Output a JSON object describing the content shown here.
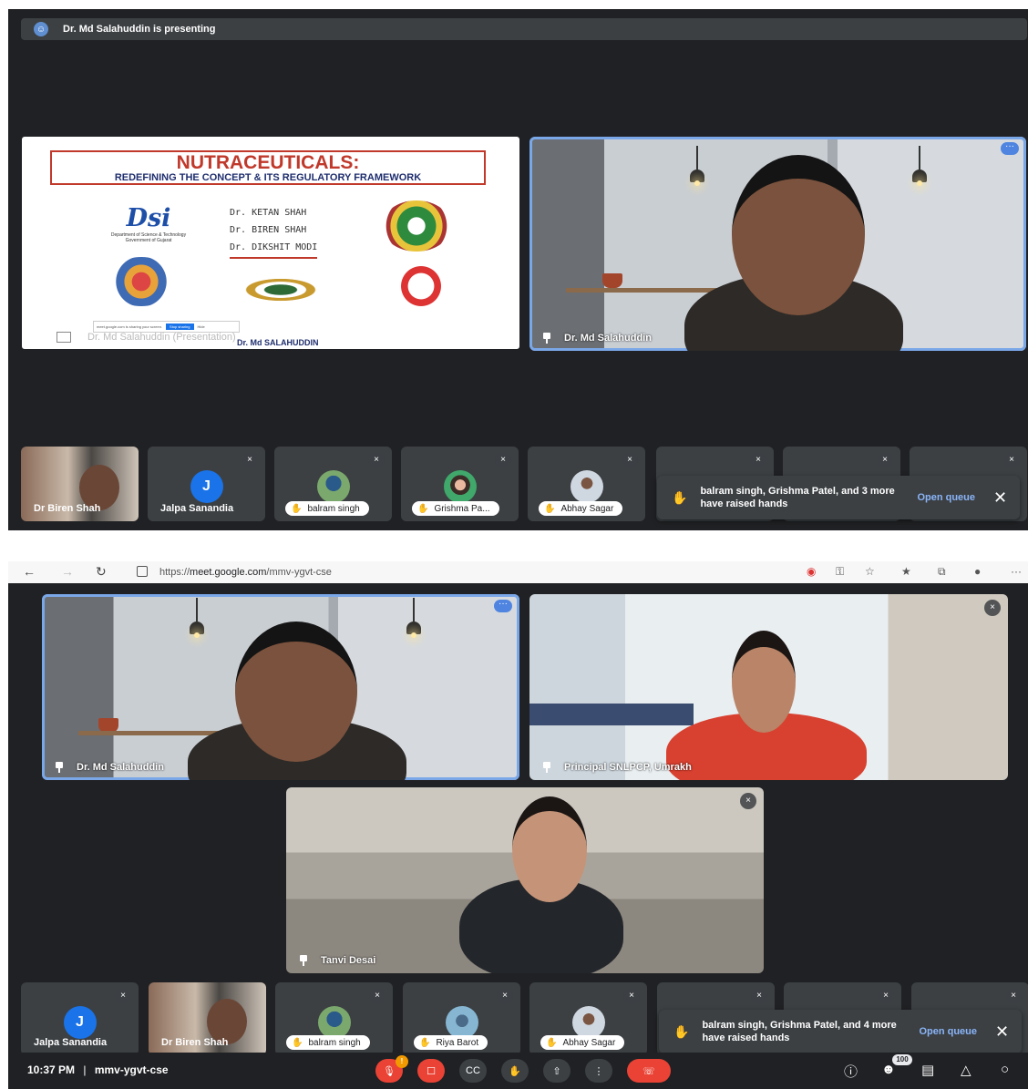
{
  "top": {
    "presenting_text": "Dr. Md Salahuddin is presenting",
    "slide": {
      "title": "NUTRACEUTICALS:",
      "subtitle": "REDEFINING THE CONCEPT & ITS REGULATORY FRAMEWORK",
      "dsi_logo": "Dsi",
      "dsi_sub": "Department of Science & Technology Government of Gujarat",
      "names": [
        "Dr. KETAN SHAH",
        "Dr. BIREN SHAH",
        "Dr. DIKSHIT MODI"
      ],
      "author": "Dr. Md SALAHUDDIN",
      "share_notice": "meet.google.com is sharing your screen.",
      "stop_sharing": "Stop sharing",
      "hide": "Hide",
      "caption": "Dr. Md Salahuddin (Presentation)"
    },
    "speaker_name": "Dr. Md Salahuddin",
    "strip": [
      {
        "name": "Dr Biren Shah"
      },
      {
        "name": "Jalpa Sanandia",
        "initial": "J"
      },
      {
        "name": "balram singh"
      },
      {
        "name": "Grishma Pa..."
      },
      {
        "name": "Abhay Sagar"
      }
    ],
    "toast": {
      "message": "balram singh, Grishma Patel, and 3 more have raised hands",
      "action": "Open queue"
    }
  },
  "browser": {
    "url_prefix": "https://",
    "url_host": "meet.google.com",
    "url_path": "/mmv-ygvt-cse"
  },
  "bottom": {
    "tiles": [
      {
        "name": "Dr. Md Salahuddin"
      },
      {
        "name": "Principal SNLPCP, Umrakh"
      },
      {
        "name": "Tanvi Desai"
      }
    ],
    "strip": [
      {
        "name": "Jalpa Sanandia",
        "initial": "J"
      },
      {
        "name": "Dr Biren Shah"
      },
      {
        "name": "balram singh"
      },
      {
        "name": "Riya Barot"
      },
      {
        "name": "Abhay Sagar"
      }
    ],
    "toast": {
      "message": "balram singh, Grishma Patel, and 4 more have raised hands",
      "action": "Open queue"
    },
    "time": "10:37 PM",
    "separator": "|",
    "meeting_code": "mmv-ygvt-cse",
    "people_count": "100",
    "alert_badge": "!"
  }
}
